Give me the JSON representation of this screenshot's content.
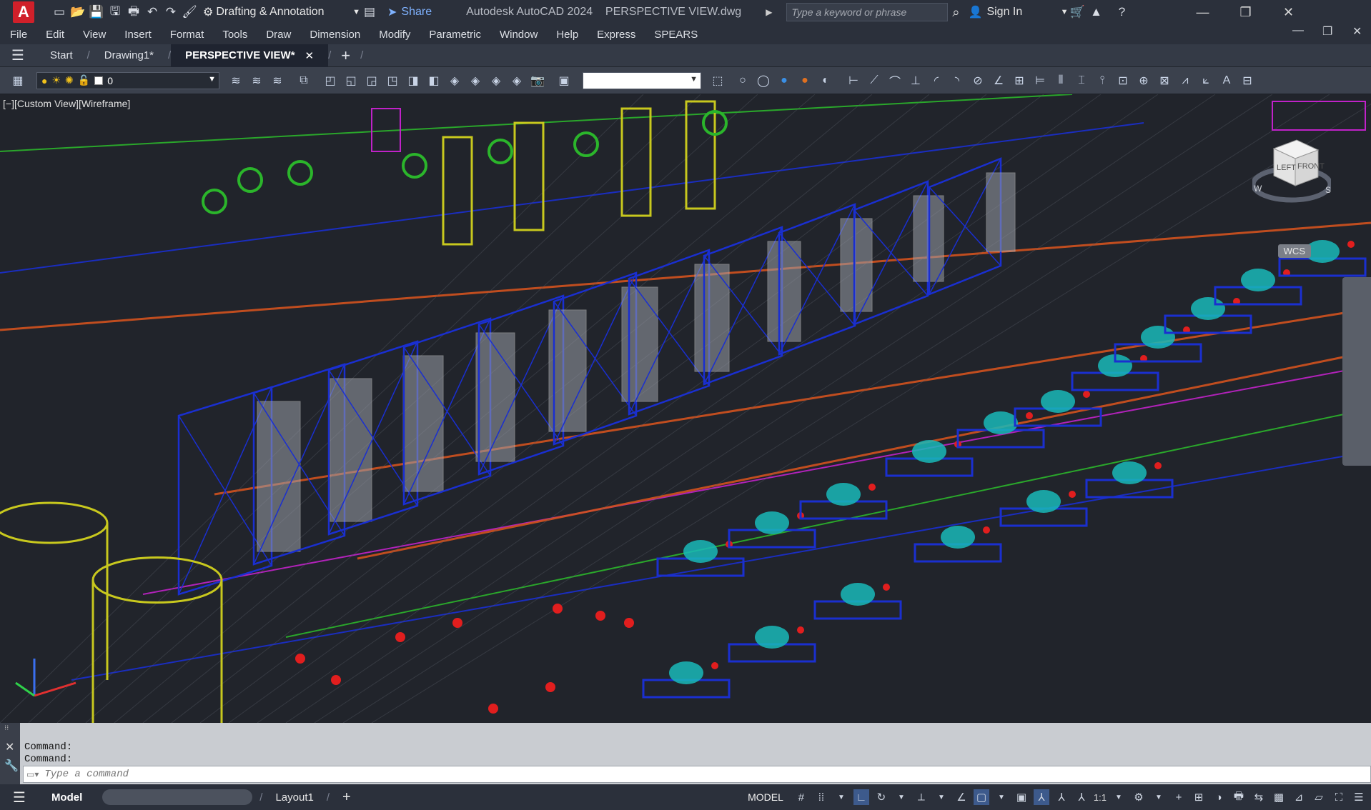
{
  "app": {
    "title": "Autodesk AutoCAD 2024",
    "file": "PERSPECTIVE VIEW.dwg",
    "workspace": "Drafting & Annotation",
    "share_label": "Share",
    "search_placeholder": "Type a keyword or phrase",
    "signin_label": "Sign In"
  },
  "menu": [
    "File",
    "Edit",
    "View",
    "Insert",
    "Format",
    "Tools",
    "Draw",
    "Dimension",
    "Modify",
    "Parametric",
    "Window",
    "Help",
    "Express",
    "SPEARS"
  ],
  "tabs": [
    {
      "label": "Start"
    },
    {
      "label": "Drawing1*"
    },
    {
      "label": "PERSPECTIVE VIEW*"
    }
  ],
  "toolbar": {
    "layer_value": "0",
    "combo2_value": ""
  },
  "viewport": {
    "label": "[−][Custom View][Wireframe]",
    "cube_left": "LEFT",
    "cube_front": "FRONT",
    "compass_w": "W",
    "compass_s": "S",
    "wcs": "WCS"
  },
  "command": {
    "history": [
      "Command:",
      "Command:"
    ],
    "placeholder": "Type a command"
  },
  "status": {
    "tabs": [
      "Model",
      "Layout1"
    ],
    "model_label": "MODEL",
    "scale": "1:1"
  },
  "colors": {
    "layer_blue": "#1a2fd0",
    "layer_yellow": "#c8c81e",
    "layer_green": "#2bb52b",
    "layer_orange": "#d2521e",
    "layer_magenta": "#c022c8",
    "layer_cyan": "#19b8b8",
    "layer_red": "#e11e1e"
  }
}
